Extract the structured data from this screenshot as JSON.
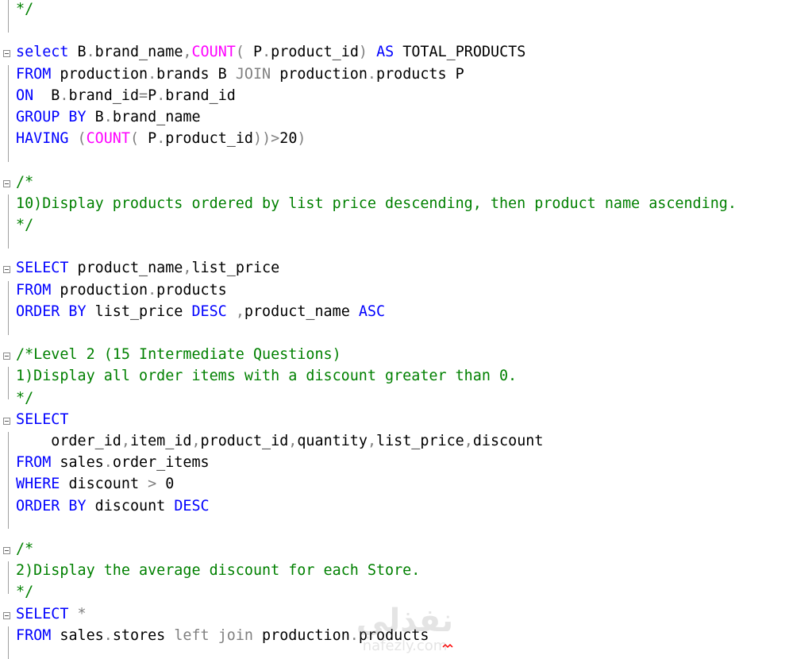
{
  "editor": {
    "lines": [
      [
        {
          "t": "*/",
          "c": "cm"
        }
      ],
      [],
      [
        {
          "t": "select",
          "c": "kw"
        },
        {
          "t": " B",
          "c": "tx"
        },
        {
          "t": ".",
          "c": "op"
        },
        {
          "t": "brand_name",
          "c": "tx"
        },
        {
          "t": ",",
          "c": "op"
        },
        {
          "t": "COUNT",
          "c": "fn"
        },
        {
          "t": "(",
          "c": "op"
        },
        {
          "t": " P",
          "c": "tx"
        },
        {
          "t": ".",
          "c": "op"
        },
        {
          "t": "product_id",
          "c": "tx"
        },
        {
          "t": ")",
          "c": "op"
        },
        {
          "t": " ",
          "c": "tx"
        },
        {
          "t": "AS",
          "c": "kw"
        },
        {
          "t": " TOTAL_PRODUCTS",
          "c": "tx"
        }
      ],
      [
        {
          "t": "FROM",
          "c": "kw"
        },
        {
          "t": " production",
          "c": "tx"
        },
        {
          "t": ".",
          "c": "op"
        },
        {
          "t": "brands B ",
          "c": "tx"
        },
        {
          "t": "JOIN",
          "c": "op"
        },
        {
          "t": " production",
          "c": "tx"
        },
        {
          "t": ".",
          "c": "op"
        },
        {
          "t": "products P",
          "c": "tx"
        }
      ],
      [
        {
          "t": "ON",
          "c": "kw"
        },
        {
          "t": "  B",
          "c": "tx"
        },
        {
          "t": ".",
          "c": "op"
        },
        {
          "t": "brand_id",
          "c": "tx"
        },
        {
          "t": "=",
          "c": "op"
        },
        {
          "t": "P",
          "c": "tx"
        },
        {
          "t": ".",
          "c": "op"
        },
        {
          "t": "brand_id",
          "c": "tx"
        }
      ],
      [
        {
          "t": "GROUP BY",
          "c": "kw"
        },
        {
          "t": " B",
          "c": "tx"
        },
        {
          "t": ".",
          "c": "op"
        },
        {
          "t": "brand_name",
          "c": "tx"
        }
      ],
      [
        {
          "t": "HAVING",
          "c": "kw"
        },
        {
          "t": " (",
          "c": "op"
        },
        {
          "t": "COUNT",
          "c": "fn"
        },
        {
          "t": "(",
          "c": "op"
        },
        {
          "t": " P",
          "c": "tx"
        },
        {
          "t": ".",
          "c": "op"
        },
        {
          "t": "product_id",
          "c": "tx"
        },
        {
          "t": "))",
          "c": "op"
        },
        {
          "t": ">",
          "c": "op"
        },
        {
          "t": "20",
          "c": "tx"
        },
        {
          "t": ")",
          "c": "op"
        }
      ],
      [],
      [
        {
          "t": "/*",
          "c": "cm"
        }
      ],
      [
        {
          "t": "10)Display products ordered by list price descending, then product name ascending.",
          "c": "cm"
        }
      ],
      [
        {
          "t": "*/",
          "c": "cm"
        }
      ],
      [],
      [
        {
          "t": "SELECT",
          "c": "kw"
        },
        {
          "t": " product_name",
          "c": "tx"
        },
        {
          "t": ",",
          "c": "op"
        },
        {
          "t": "list_price",
          "c": "tx"
        }
      ],
      [
        {
          "t": "FROM",
          "c": "kw"
        },
        {
          "t": " production",
          "c": "tx"
        },
        {
          "t": ".",
          "c": "op"
        },
        {
          "t": "products",
          "c": "tx"
        }
      ],
      [
        {
          "t": "ORDER BY",
          "c": "kw"
        },
        {
          "t": " list_price ",
          "c": "tx"
        },
        {
          "t": "DESC",
          "c": "kw"
        },
        {
          "t": " ",
          "c": "tx"
        },
        {
          "t": ",",
          "c": "op"
        },
        {
          "t": "product_name ",
          "c": "tx"
        },
        {
          "t": "ASC",
          "c": "kw"
        }
      ],
      [],
      [
        {
          "t": "/*Level 2 (15 Intermediate Questions)",
          "c": "cm"
        }
      ],
      [
        {
          "t": "1)Display all order items with a discount greater than 0.",
          "c": "cm"
        }
      ],
      [
        {
          "t": "*/",
          "c": "cm"
        }
      ],
      [
        {
          "t": "SELECT",
          "c": "kw"
        }
      ],
      [
        {
          "t": "    order_id",
          "c": "tx"
        },
        {
          "t": ",",
          "c": "op"
        },
        {
          "t": "item_id",
          "c": "tx"
        },
        {
          "t": ",",
          "c": "op"
        },
        {
          "t": "product_id",
          "c": "tx"
        },
        {
          "t": ",",
          "c": "op"
        },
        {
          "t": "quantity",
          "c": "tx"
        },
        {
          "t": ",",
          "c": "op"
        },
        {
          "t": "list_price",
          "c": "tx"
        },
        {
          "t": ",",
          "c": "op"
        },
        {
          "t": "discount",
          "c": "tx"
        }
      ],
      [
        {
          "t": "FROM",
          "c": "kw"
        },
        {
          "t": " sales",
          "c": "tx"
        },
        {
          "t": ".",
          "c": "op"
        },
        {
          "t": "order_items",
          "c": "tx"
        }
      ],
      [
        {
          "t": "WHERE",
          "c": "kw"
        },
        {
          "t": " discount ",
          "c": "tx"
        },
        {
          "t": ">",
          "c": "op"
        },
        {
          "t": " 0",
          "c": "tx"
        }
      ],
      [
        {
          "t": "ORDER BY",
          "c": "kw"
        },
        {
          "t": " discount ",
          "c": "tx"
        },
        {
          "t": "DESC",
          "c": "kw"
        }
      ],
      [],
      [
        {
          "t": "/*",
          "c": "cm"
        }
      ],
      [
        {
          "t": "2)Display the average discount for each Store.",
          "c": "cm"
        }
      ],
      [
        {
          "t": "*/",
          "c": "cm"
        }
      ],
      [
        {
          "t": "SELECT",
          "c": "kw"
        },
        {
          "t": " *",
          "c": "op"
        }
      ],
      [
        {
          "t": "FROM",
          "c": "kw"
        },
        {
          "t": " sales",
          "c": "tx"
        },
        {
          "t": ".",
          "c": "op"
        },
        {
          "t": "stores ",
          "c": "tx"
        },
        {
          "t": "left join",
          "c": "op"
        },
        {
          "t": " production",
          "c": "tx"
        },
        {
          "t": ".",
          "c": "op"
        },
        {
          "t": "products",
          "c": "tx"
        }
      ]
    ],
    "colors": {
      "keyword": "#0000ff",
      "function": "#ff00ff",
      "comment": "#008000",
      "operator": "#808080",
      "text": "#000000",
      "error_squiggle": "#ff0000"
    }
  },
  "watermark": {
    "main": "نفذلي",
    "sub": "nafezly.com"
  }
}
